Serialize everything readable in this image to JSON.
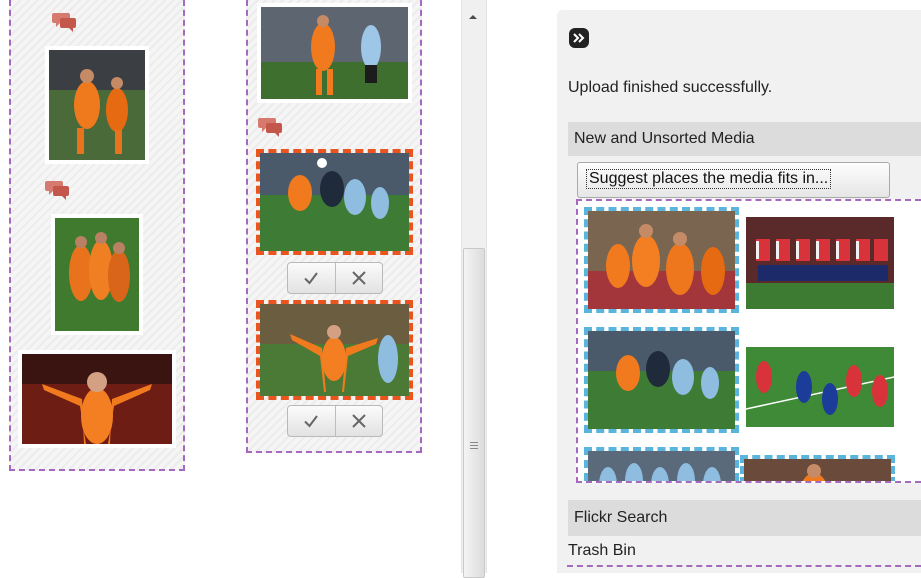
{
  "left_board": {
    "icons": {
      "comment": "comment-bubbles-icon",
      "accept": "checkmark-icon",
      "reject": "x-icon"
    },
    "colors": {
      "column_border": "#a569c0",
      "selected_red": "#e9541f",
      "selected_blue": "#5ab4dc",
      "comment_icon": "#d6796e"
    }
  },
  "right_panel": {
    "expand_icon": "double-chevron-right-icon",
    "status_message": "Upload finished successfully.",
    "sections": {
      "new_unsorted": "New and Unsorted Media",
      "flickr": "Flickr Search",
      "trash": "Trash Bin"
    },
    "suggest_button": "Suggest places the media fits in..."
  },
  "scrollbar": {
    "up_arrow_icon": "arrow-up-icon",
    "grip_icon": "grip-lines-icon"
  }
}
